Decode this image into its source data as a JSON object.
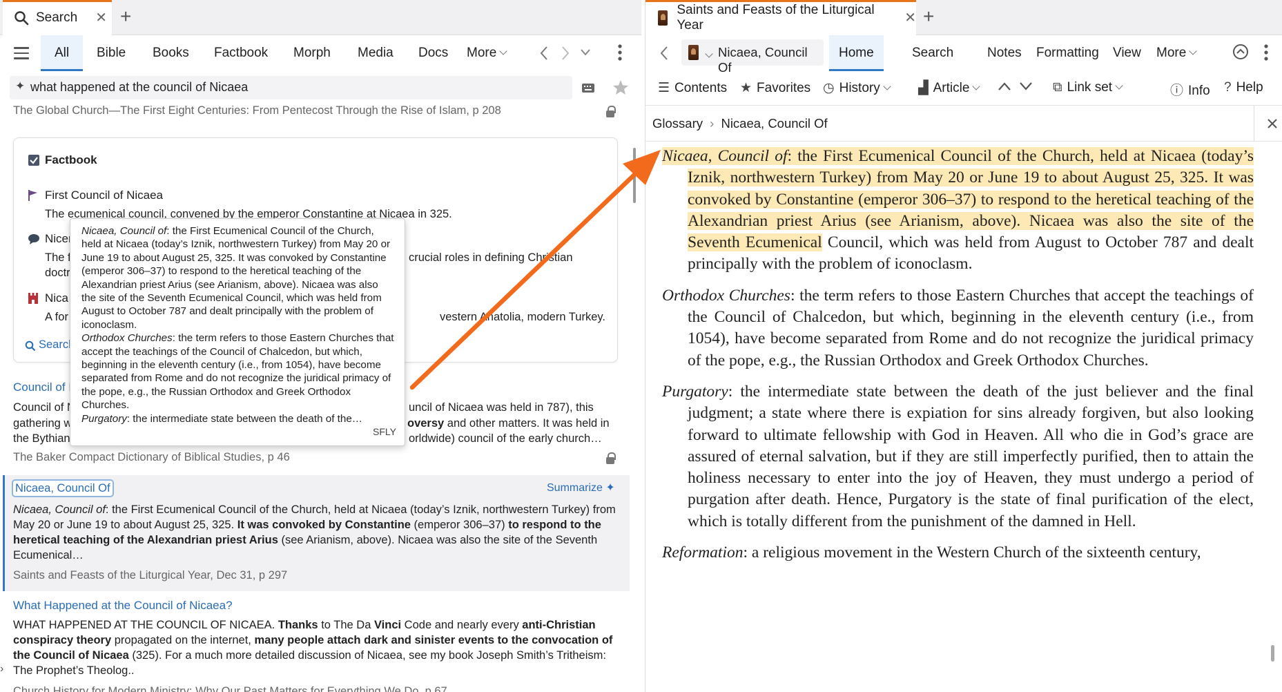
{
  "left": {
    "tab": {
      "title": "Search",
      "close": "✕"
    },
    "nav_tabs": [
      "All",
      "Bible",
      "Books",
      "Factbook",
      "Morph",
      "Media",
      "Docs",
      "More"
    ],
    "search": {
      "query": "what happened at the council of Nicaea"
    },
    "top_result_source": "The Global Church—The First Eight Centuries: From Pentecost Through the Rise of Islam, p 208",
    "factbook": {
      "heading": "Factbook",
      "item1_title": "First Council of Nicaea",
      "item1_text": "The ecumenical council, convened by the emperor Constantine at Nicaea in 325.",
      "item2_title": "Nicen",
      "item2_text": "The f",
      "item2_text_b": "doctr",
      "item2_right": "crucial roles in defining Christian",
      "item3_title": "Nica",
      "item3_text": "A for",
      "item3_right": "vestern Anatolia, modern Turkey.",
      "search_link": "Search"
    },
    "popup": {
      "term1": "Nicaea, Council of",
      "def1": ": the First Ecumenical Council of the Church, held at Nicaea (today’s Iznik, northwestern Turkey) from May 20 or June 19 to about August 25, 325. It was convoked by Constantine (emperor 306–37) to respond to the heretical teaching of the Alexandrian priest Arius (see Arianism, above). Nicaea was also the site of the Seventh Ecumenical Council, which was held from August to October 787 and dealt principally with the problem of iconoclasm.",
      "term2": "Orthodox Churches",
      "def2": ": the term refers to those Eastern Churches that accept the teachings of the Council of Chalcedon, but which, beginning in the eleventh century (i.e., from 1054), have become separated from Rome and do not recognize the juridical primacy of the pope, e.g., the Russian Orthodox and Greek Orthodox Churches.",
      "term3": "Purgatory",
      "def3": ": the intermediate state between the death of the…",
      "tag": "SFLY"
    },
    "result2": {
      "title": "Council of N",
      "line1_left": "Council of N",
      "line1_right": "uncil of Nicaea was held in 787), this",
      "line2_left": "gathering w",
      "line2_right_bold": "oversy",
      "line2_right": " and other matters. It was held in",
      "line3_left": "the Bythian",
      "line3_right": "orldwide) council of the early church…",
      "source": "The Baker Compact Dictionary of Biblical Studies, p 46"
    },
    "result3": {
      "title": "Nicaea, Council Of",
      "summarize": "Summarize",
      "term": "Nicaea, Council of",
      "t1": ": the First Ecumenical Council of the Church, held at Nicaea (today’s Iznik, northwestern Turkey) from May 20 or June 19 to about August 25, 325. ",
      "b1": "It was convoked by Constantine",
      "t2": " (emperor 306–37) ",
      "b2": "to respond to the heretical teaching of the Alexandrian priest Arius",
      "t3": " (see Arianism, above). Nicaea was also the site of the Seventh Ecumenical…",
      "source": "Saints and Feasts of the Liturgical Year, Dec 31, p 297"
    },
    "result4": {
      "title": "What Happened at the Council of Nicaea?",
      "t1": "WHAT HAPPENED AT THE COUNCIL OF NICAEA. ",
      "b1": "Thanks",
      "t2": " to The Da ",
      "b2": "Vinci",
      "t3": " Code and nearly every ",
      "b3": "anti-Christian conspiracy theory",
      "t4": " propagated on the internet, ",
      "b4": "many people attach dark and sinister events to the convocation of the Council of Nicaea",
      "t5": " (325). For a much more detailed discussion of Nicaea, see my book Joseph Smith’s Tritheism: The Prophet’s Theolog..",
      "source_partial": "Church History for Modern Ministry: Why Our Past Matters for Everything We Do, p 67"
    }
  },
  "right": {
    "tab": {
      "title": "Saints and Feasts of the Liturgical Year",
      "close": "✕"
    },
    "reference": "Nicaea, Council Of",
    "nav_tabs": [
      "Home",
      "Search",
      "Notes",
      "Formatting",
      "View",
      "More"
    ],
    "toolbar": {
      "contents": "Contents",
      "favorites": "Favorites",
      "history": "History",
      "article": "Article",
      "linkset": "Link set",
      "info": "Info",
      "help": "Help"
    },
    "breadcrumb": {
      "root": "Glossary",
      "sep": "›",
      "leaf": "Nicaea, Council Of"
    },
    "entries": {
      "e1_term": "Nicaea, Council of",
      "e1_hl": ": the First Ecumenical Council of the Church, held at Nicaea (today’s Iznik, northwestern Turkey) from May 20 or June 19 to about August 25, 325. It was convoked by Constantine (emperor 306–37) to respond to the heretical teaching of the Alexandrian priest Arius (see Arianism, above). Nicaea was also the site of the Seventh Ecumenical",
      "e1_rest": " Council, which was held from August to October 787 and dealt principally with the problem of iconoclasm.",
      "e2_term": "Orthodox Churches",
      "e2_text": ": the term refers to those Eastern Churches that accept the teachings of the Council of Chalcedon, but which, beginning in the eleventh century (i.e., from 1054), have become separated from Rome and do not recognize the juridical primacy of the pope, e.g., the Russian Orthodox and Greek Orthodox Churches.",
      "e3_term": "Purgatory",
      "e3_text": ": the intermediate state between the death of the just believer and the final judgment; a state where there is expiation for sins already forgiven, but also looking forward to ultimate fellowship with God in Heaven. All who die in God’s grace are assured of eternal salvation, but if they are still imperfectly purified, then to attain the holiness necessary to enter into the joy of Heaven, they must undergo a period of purgation after death. Hence, Purgatory is the state of final purification of the elect, which is totally different from the punishment of the damned in Hell.",
      "e4_term": "Reformation",
      "e4_text": ": a religious movement in the Western Church of the sixteenth century,"
    }
  },
  "colors": {
    "accent_orange": "#e8751a",
    "link_blue": "#2a6db5",
    "highlight": "#fde9b5",
    "tab_underline": "#2f78c4"
  }
}
